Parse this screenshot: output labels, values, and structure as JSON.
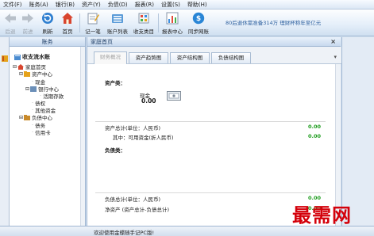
{
  "menu": [
    "文件(F)",
    "账务(A)",
    "银行(B)",
    "资产(Y)",
    "负债(D)",
    "报表(R)",
    "设置(S)",
    "帮助(H)"
  ],
  "toolbar": {
    "back": "后退",
    "forward": "前进",
    "refresh": "刷新",
    "home": "首页",
    "note": "记一笔",
    "accounts": "账户列表",
    "categories": "收支类目",
    "report_center": "报表中心",
    "sync": "同步网账",
    "ticker": "80后退休需准备314万  理财杯称年至亿元"
  },
  "sidebar": {
    "title": "账务",
    "root": "收支流水账",
    "home": "家庭首页",
    "assets": "资产中心",
    "cash": "现金",
    "bank": "银行中心",
    "current_deposit": "活期存款",
    "claims": "债权",
    "other_funds": "其他资金",
    "liabilities": "负债中心",
    "debts": "债务",
    "credit_card": "信用卡"
  },
  "document_tab": "家庭首页",
  "tabs": [
    "财务概况",
    "资产趋势图",
    "资产结构图",
    "负债结构图"
  ],
  "overview": {
    "assets_heading": "资产类：",
    "cash_label": "现金",
    "cash_value": "0.00",
    "total_assets_label": "资产总计(单位：人民币)",
    "total_assets_value": "0.00",
    "available_label": "其中：可用资金(折人民币)",
    "available_value": "0.00",
    "liabilities_heading": "负债类：",
    "total_liab_label": "负债总计(单位：人民币)",
    "total_liab_value": "0.00",
    "net_label": "净资产 (资产总计-负债总计)",
    "net_value": "0.00"
  },
  "status": "欢迎使用金蝶随手记PC版!",
  "watermark": "最需网"
}
